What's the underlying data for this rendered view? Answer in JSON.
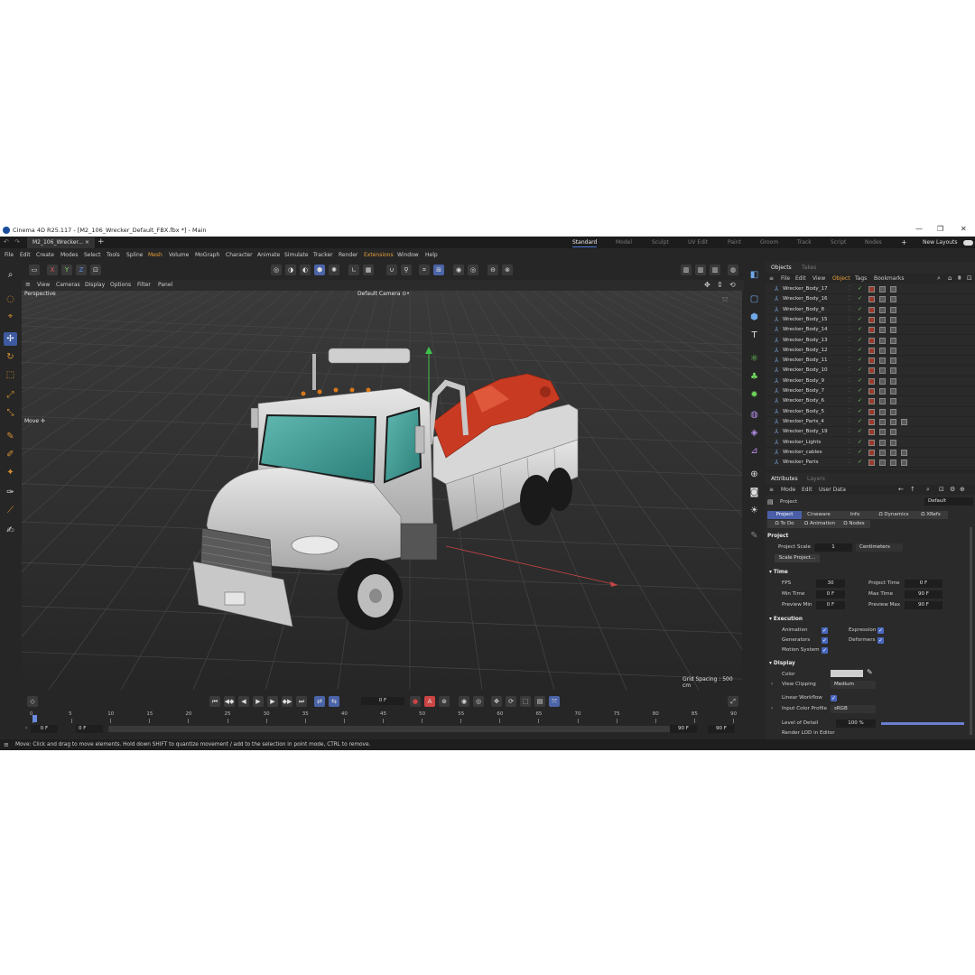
{
  "titlebar": {
    "title": "Cinema 4D R25.117 - [M2_106_Wrecker_Default_FBX.fbx *] - Main",
    "min": "—",
    "max": "❐",
    "close": "✕"
  },
  "tabs": {
    "doc": "M2_106_Wrecker...",
    "doc_close": "×",
    "add": "+",
    "layouts": [
      "Standard",
      "Model",
      "Sculpt",
      "UV Edit",
      "Paint",
      "Groom",
      "Track",
      "Script",
      "Nodes"
    ],
    "new_layouts": "New Layouts"
  },
  "menu": [
    "File",
    "Edit",
    "Create",
    "Modes",
    "Select",
    "Tools",
    "Spline",
    "Mesh",
    "Volume",
    "MoGraph",
    "Character",
    "Animate",
    "Simulate",
    "Tracker",
    "Render",
    "Extensions",
    "Window",
    "Help"
  ],
  "viewport": {
    "menu": [
      "View",
      "Cameras",
      "Display",
      "Options",
      "Filter",
      "Panel"
    ],
    "label": "Perspective",
    "camera": "Default Camera ⊙•",
    "move": "Move ✢",
    "grid_spacing": "Grid Spacing : 500 cm"
  },
  "toolbar": {
    "x": "X",
    "y": "Y",
    "z": "Z"
  },
  "timeline": {
    "frame": "0 F",
    "ticks": [
      "0",
      "5",
      "10",
      "15",
      "20",
      "25",
      "30",
      "35",
      "40",
      "45",
      "50",
      "55",
      "60",
      "65",
      "70",
      "75",
      "80",
      "85",
      "90"
    ],
    "start": "0 F",
    "start2": "0 F",
    "end": "90 F",
    "end2": "90 F"
  },
  "objects": {
    "tabs": [
      "Objects",
      "Takes"
    ],
    "menu": [
      "File",
      "Edit",
      "View",
      "Object",
      "Tags",
      "Bookmarks"
    ],
    "items": [
      "Wrecker_Body_17",
      "Wrecker_Body_16",
      "Wrecker_Body_8",
      "Wrecker_Body_15",
      "Wrecker_Body_14",
      "Wrecker_Body_13",
      "Wrecker_Body_12",
      "Wrecker_Body_11",
      "Wrecker_Body_10",
      "Wrecker_Body_9",
      "Wrecker_Body_7",
      "Wrecker_Body_6",
      "Wrecker_Body_5",
      "Wrecker_Parts_4",
      "Wrecker_Body_19",
      "Wrecker_Lights",
      "Wrecker_cables",
      "Wrecker_Parts"
    ]
  },
  "attributes": {
    "tabs": [
      "Attributes",
      "Layers"
    ],
    "menu": [
      "Mode",
      "Edit",
      "User Data"
    ],
    "breadcrumb": "Project",
    "preset": "Default",
    "subtabs": [
      "Project",
      "Cineware",
      "Info",
      "Ω Dynamics",
      "Ω XRefs"
    ],
    "subtabs2": [
      "Ω To Do",
      "Ω Animation",
      "Ω Nodes"
    ],
    "section_project": "Project",
    "scale_label": "Project Scale",
    "scale_value": "1",
    "scale_unit": "Centimeters",
    "scale_button": "Scale Project...",
    "time": {
      "title": "▾ Time",
      "fps_label": "FPS",
      "fps": "30",
      "project_time_label": "Project Time",
      "project_time": "0 F",
      "min_time_label": "Min Time",
      "min_time": "0 F",
      "max_time_label": "Max Time",
      "max_time": "90 F",
      "preview_min_label": "Preview Min",
      "preview_min": "0 F",
      "preview_max_label": "Preview Max",
      "preview_max": "90 F"
    },
    "execution": {
      "title": "▾ Execution",
      "animation": "Animation",
      "generators": "Generators",
      "motion_system": "Motion System",
      "expression": "Expression",
      "deformers": "Deformers"
    },
    "display": {
      "title": "▾ Display",
      "color_label": "Color",
      "view_clipping_label": "View Clipping",
      "view_clipping": "Medium",
      "linear_workflow_label": "Linear Workflow",
      "input_color_profile_label": "Input Color Profile",
      "input_color_profile": "sRGB",
      "lod_label": "Level of Detail",
      "lod": "100 %",
      "render_lod_label": "Render LOD in Editor"
    }
  },
  "status": "Move: Click and drag to move elements. Hold down SHIFT to quantize movement / add to the selection in point mode, CTRL to remove.",
  "colors": {
    "accent": "#4a6fd1",
    "bg": "#262626",
    "panel": "#2a2a2a",
    "highlight": "#e6a03a"
  }
}
